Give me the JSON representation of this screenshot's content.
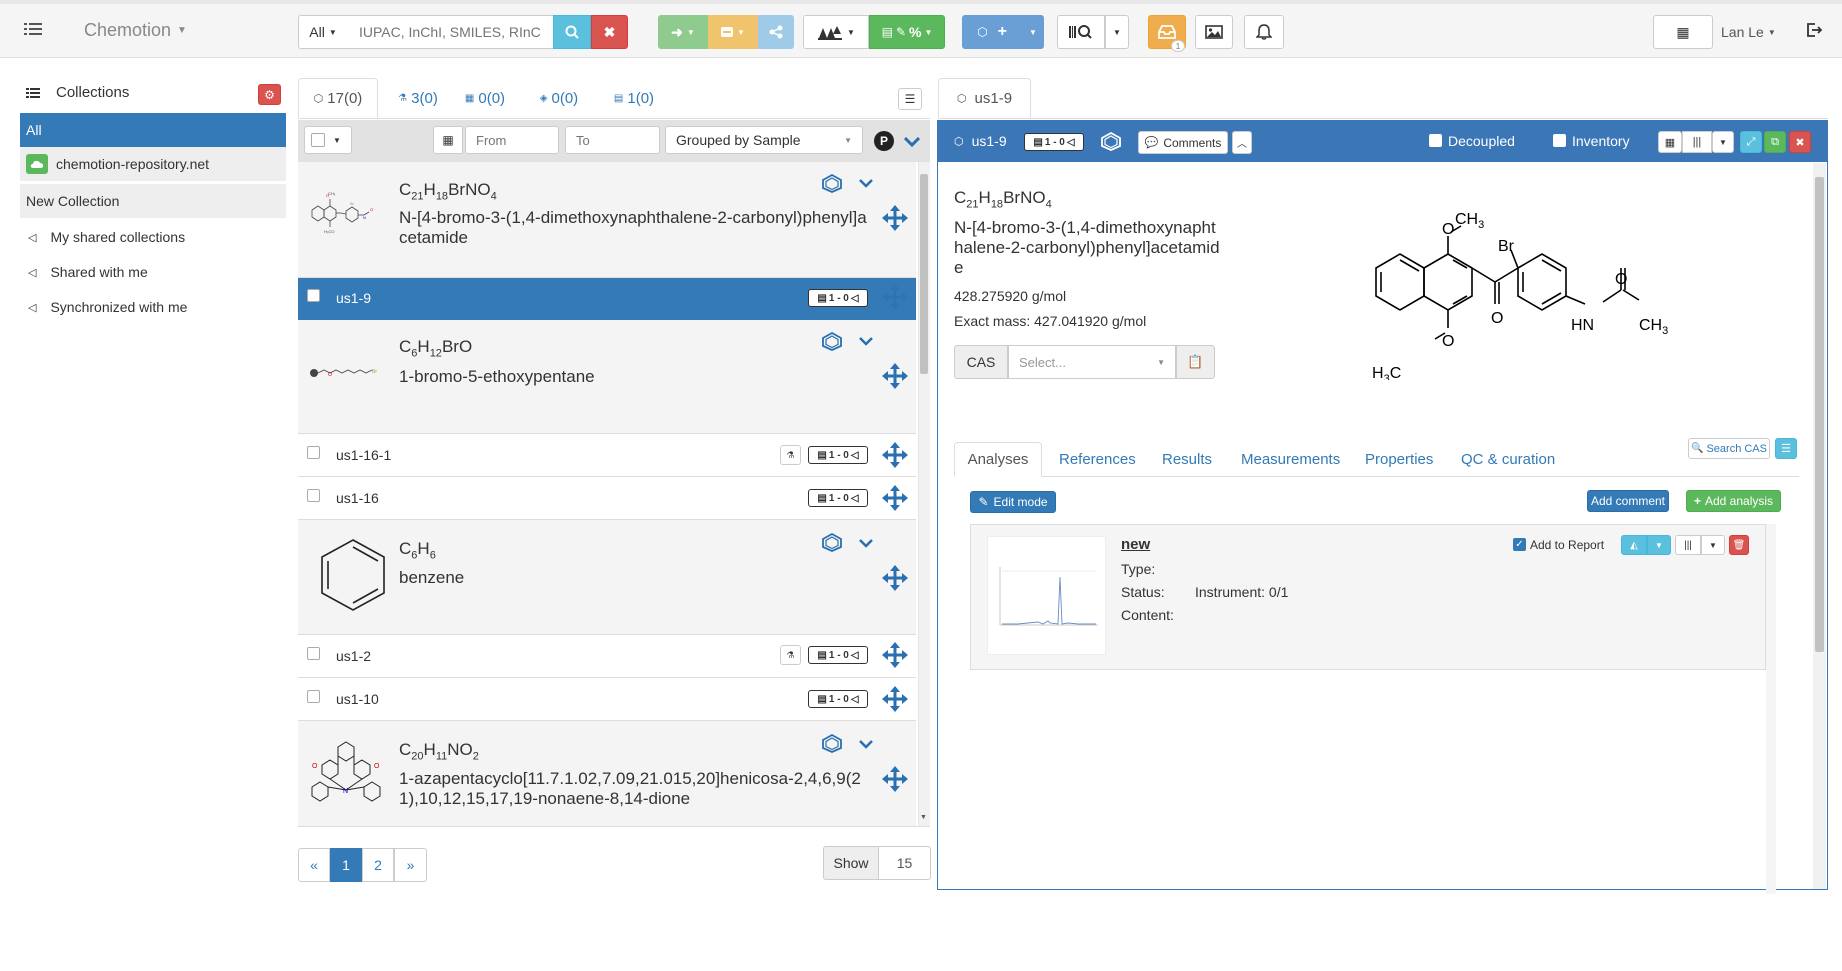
{
  "app": {
    "brand": "Chemotion",
    "user": "Lan Le"
  },
  "search": {
    "scope": "All",
    "placeholder": "IUPAC, InChI, SMILES, RInC"
  },
  "toolbar": {
    "inbox_badge": "1"
  },
  "sidebar": {
    "title": "Collections",
    "items": [
      {
        "label": "All"
      },
      {
        "label": "chemotion-repository.net"
      },
      {
        "label": "New Collection"
      },
      {
        "label": "My shared collections"
      },
      {
        "label": "Shared with me"
      },
      {
        "label": "Synchronized with me"
      }
    ]
  },
  "list": {
    "tabs": [
      {
        "label": "17(0)",
        "icon": "sample-icon"
      },
      {
        "label": "3(0)",
        "icon": "reaction-icon"
      },
      {
        "label": "0(0)",
        "icon": "wellplate-icon"
      },
      {
        "label": "0(0)",
        "icon": "screen-icon"
      },
      {
        "label": "1(0)",
        "icon": "research-plan-icon"
      }
    ],
    "filter": {
      "from_placeholder": "From",
      "to_placeholder": "To",
      "group_by": "Grouped by Sample",
      "p_label": "P"
    },
    "molecules": [
      {
        "formula_html": "C<sub>21</sub>H<sub>18</sub>BrNO<sub>4</sub>",
        "name": "N-[4-bromo-3-(1,4-dimethoxynaphthalene-2-carbonyl)phenyl]acetamide"
      },
      {
        "formula_html": "C<sub>6</sub>H<sub>12</sub>BrO",
        "name": "1-bromo-5-ethoxypentane"
      },
      {
        "formula_html": "C<sub>6</sub>H<sub>6</sub>",
        "name": "benzene"
      },
      {
        "formula_html": "C<sub>20</sub>H<sub>11</sub>NO<sub>2</sub>",
        "name": "1-azapentacyclo[11.7.1.02,7.09,21.015,20]henicosa-2,4,6,9(21),10,12,15,17,19-nonaene-8,14-dione"
      }
    ],
    "samples": [
      {
        "label": "us1-9",
        "tag": "1 - 0"
      },
      {
        "label": "us1-16-1",
        "tag": "1 - 0"
      },
      {
        "label": "us1-16",
        "tag": "1 - 0"
      },
      {
        "label": "us1-2",
        "tag": "1 - 0"
      },
      {
        "label": "us1-10",
        "tag": "1 - 0"
      }
    ],
    "pagination": {
      "prev": "«",
      "pages": [
        "1",
        "2"
      ],
      "next": "»",
      "show_label": "Show",
      "show_value": "15"
    }
  },
  "detail": {
    "tab_label": "us1-9",
    "header": {
      "title": "us1-9",
      "tag": "1 - 0",
      "comments": "Comments",
      "decoupled": "Decoupled",
      "inventory": "Inventory"
    },
    "formula_html": "C<sub>21</sub>H<sub>18</sub>BrNO<sub>4</sub>",
    "name": "N-[4-bromo-3-(1,4-dimethoxynaphthalene-2-carbonyl)phenyl]acetamide",
    "molar_mass": "428.275920 g/mol",
    "exact_mass": "Exact mass: 427.041920 g/mol",
    "cas_label": "CAS",
    "cas_placeholder": "Select...",
    "structure_labels": {
      "och3": "O",
      "ch3": "CH",
      "ch3_sub": "3",
      "br": "Br",
      "o_ketone": "O",
      "o_amide": "O",
      "hn": "HN",
      "me": "CH",
      "me_sub": "3",
      "h3c": "H",
      "h3c_sub": "3",
      "h3c_c": "C",
      "o_methoxy": "O"
    },
    "tabs": [
      "Analyses",
      "References",
      "Results",
      "Measurements",
      "Properties",
      "QC & curation"
    ],
    "search_cas": "Search CAS",
    "edit_mode": "Edit mode",
    "add_comment": "Add comment",
    "add_analysis": "Add analysis",
    "analysis": {
      "title": "new",
      "type": "Type:",
      "status": "Status:",
      "instrument": "Instrument: 0/1",
      "content": "Content:",
      "add_to_report": "Add to Report"
    }
  },
  "colors": {
    "primary": "#337ab7",
    "danger": "#d9534f",
    "success": "#5cb85c",
    "header_blue": "#3b76b6",
    "green_light": "#8fcb8f",
    "orange_light": "#f0c36d",
    "info_light": "#9fcbe8",
    "warning": "#f0ad4e"
  }
}
